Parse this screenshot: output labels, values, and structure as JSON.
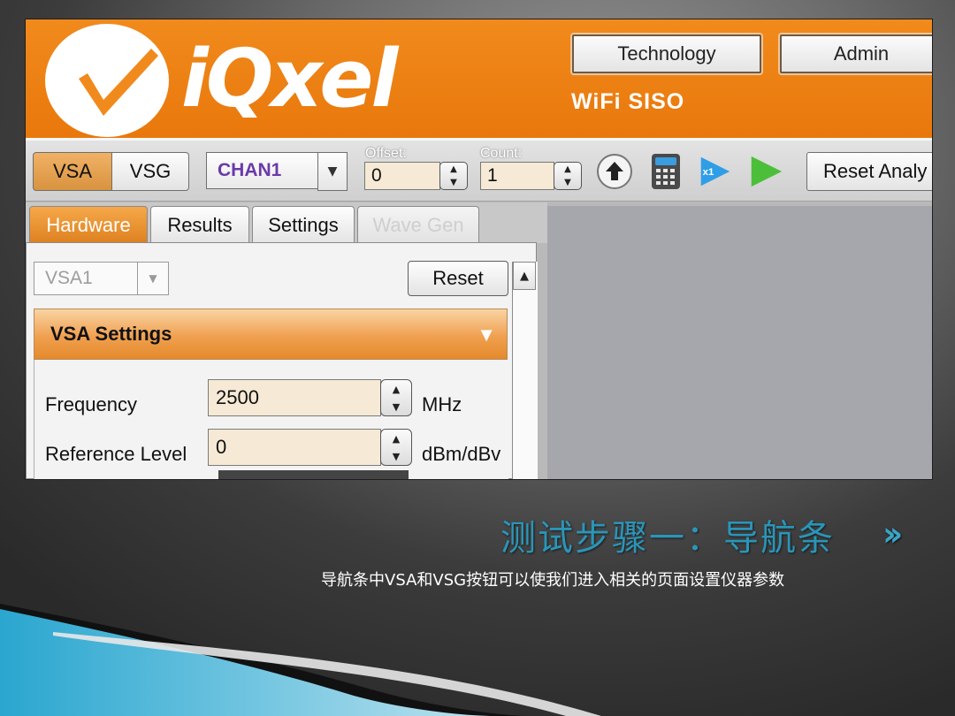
{
  "header": {
    "logo_text": "iQxel",
    "buttons": [
      "Technology",
      "Admin"
    ],
    "subtitle": "WiFi SISO",
    "accent_color": "#ed7f12"
  },
  "toolbar": {
    "mode_buttons": [
      "VSA",
      "VSG"
    ],
    "active_mode": "VSA",
    "channel": "CHAN1",
    "offset": {
      "label": "Offset:",
      "value": "0"
    },
    "count": {
      "label": "Count:",
      "value": "1"
    },
    "icons": [
      "upload-icon",
      "calculator-icon",
      "run-once-icon",
      "play-icon"
    ],
    "run_once_badge": "x1",
    "reset_label": "Reset Analy"
  },
  "tabs": [
    "Hardware",
    "Results",
    "Settings",
    "Wave Gen"
  ],
  "active_tab": "Hardware",
  "panel": {
    "analyzer_select": "VSA1",
    "reset_label": "Reset",
    "section_title": "VSA Settings",
    "fields": [
      {
        "label": "Frequency",
        "value": "2500",
        "unit": "MHz"
      },
      {
        "label": "Reference Level",
        "value": "0",
        "unit": "dBm/dBv"
      }
    ]
  },
  "slide": {
    "title": "测试步骤一：导航条",
    "subtitle": "导航条中VSA和VSG按钮可以使我们进入相关的页面设置仪器参数",
    "title_color": "#2a95b8"
  }
}
